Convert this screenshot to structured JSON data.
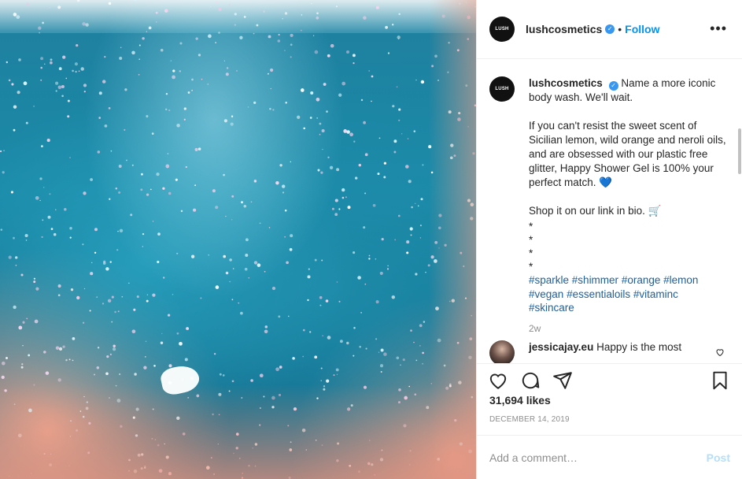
{
  "post": {
    "username": "lushcosmetics",
    "avatar_text": "LUSH",
    "follow_label": "Follow",
    "separator": "•",
    "more_label": "•••",
    "verified_mark": "✓"
  },
  "caption": {
    "username": "lushcosmetics",
    "line1": "Name a more iconic body wash. We'll wait.",
    "paragraph2": "If you can't resist the sweet scent of Sicilian lemon, wild orange and neroli oils, and are obsessed with our plastic free glitter, Happy Shower Gel is 100% your perfect match. 💙",
    "shop_line": "Shop it on our link in bio. 🛒",
    "stars": [
      "*",
      "*",
      "*",
      "*"
    ],
    "hashtags": [
      "#sparkle",
      "#shimmer",
      "#orange",
      "#lemon",
      "#vegan",
      "#essentialoils",
      "#vitaminc",
      "#skincare"
    ],
    "age": "2w"
  },
  "reply": {
    "username": "jessicajay.eu",
    "text": "Happy is the most"
  },
  "actions": {
    "icons": [
      "heart-icon",
      "comment-icon",
      "share-icon",
      "bookmark-icon"
    ]
  },
  "likes": "31,694 likes",
  "date": "DECEMBER 14, 2019",
  "comment_box": {
    "placeholder": "Add a comment…",
    "post_label": "Post"
  },
  "colors": {
    "accent": "#0095f6",
    "post_disabled": "#b2dffc",
    "muted": "#8e8e8e"
  }
}
